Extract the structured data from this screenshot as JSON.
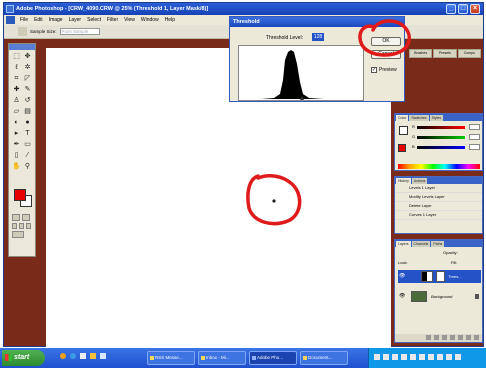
{
  "window": {
    "title": "Adobe Photoshop - [CRW_4090.CRW @ 25% (Threshold 1, Layer Mask/8)]",
    "controls": [
      "_",
      "□",
      "×"
    ]
  },
  "menubar": {
    "items": [
      "File",
      "Edit",
      "Image",
      "Layer",
      "Select",
      "Filter",
      "View",
      "Window",
      "Help"
    ]
  },
  "options_bar": {
    "sample_size_label": "Sample Size:",
    "sample_size_value": "Point Sample"
  },
  "palette_well": [
    "Brushes",
    "Presets",
    "Comps"
  ],
  "threshold_dialog": {
    "title": "Threshold",
    "level_label": "Threshold Level:",
    "level_value": "128",
    "ok_label": "OK",
    "cancel_label": "Cancel",
    "preview_label": "Preview",
    "preview_checked": true
  },
  "color_panel": {
    "tabs": [
      "Color",
      "Swatches",
      "Styles"
    ],
    "labels": [
      "R",
      "G",
      "B"
    ],
    "values": [
      "",
      "",
      ""
    ]
  },
  "history_panel": {
    "tabs": [
      "History",
      "Actions"
    ],
    "items": [
      "Levels 1 Layer",
      "Modify Levels Layer",
      "Delete Layer",
      "Curves 1 Layer"
    ]
  },
  "layers_panel": {
    "tabs": [
      "Layers",
      "Channels",
      "Paths"
    ],
    "opacity_label": "Opacity:",
    "lock_label": "Lock:",
    "fill_label": "Fill:",
    "layers": [
      {
        "name": "Thres...",
        "selected": true
      },
      {
        "name": "Background",
        "selected": false
      }
    ]
  },
  "taskbar": {
    "start_label": "start",
    "tasks": [
      "RSS Messe...",
      "Inbox - Mi...",
      "Adobe Pho...",
      "Document..."
    ],
    "clock": ""
  },
  "colors": {
    "annotation_red": "#e01b1b",
    "foreground_swatch": "#e60000",
    "workspace": "#7a2a18",
    "xp_blue": "#1e4fcf"
  },
  "annotations": [
    "red-circle-ok-button",
    "red-circle-canvas-point"
  ]
}
